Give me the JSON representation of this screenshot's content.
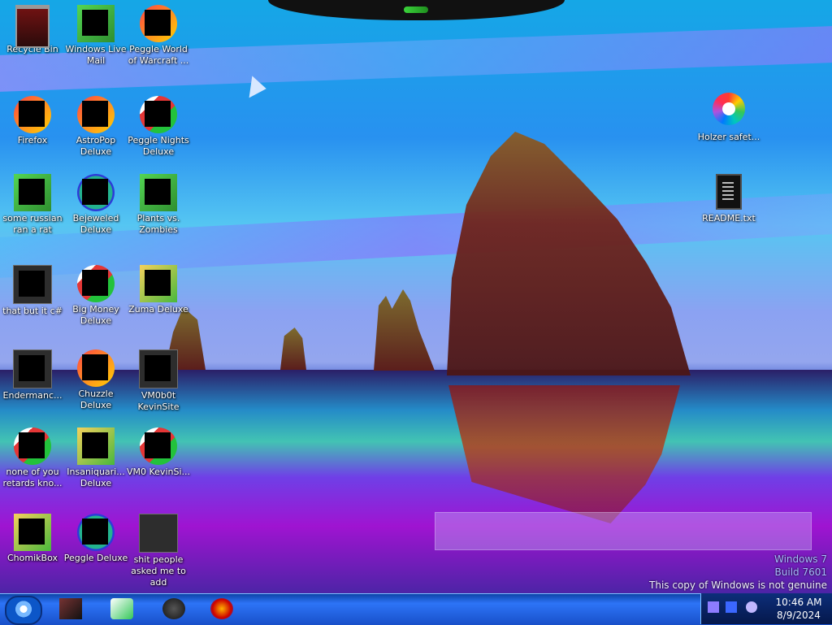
{
  "desktop": {
    "icons": [
      {
        "label": "Recycle Bin",
        "icon": "recycle-bin-icon"
      },
      {
        "label": "Windows Live Mail",
        "icon": "mail-icon"
      },
      {
        "label": "Peggle World of Warcraft ...",
        "icon": "game-icon"
      },
      {
        "label": "Firefox",
        "icon": "firefox-icon"
      },
      {
        "label": "AstroPop Deluxe",
        "icon": "game-icon"
      },
      {
        "label": "Peggle Nights Deluxe",
        "icon": "game-icon"
      },
      {
        "label": "Holzer safet...",
        "icon": "color-wheel-icon"
      },
      {
        "label": "README.txt",
        "icon": "text-file-icon"
      },
      {
        "label": "some russian ran a rat",
        "icon": "game-icon"
      },
      {
        "label": "Bejeweled Deluxe",
        "icon": "game-icon"
      },
      {
        "label": "Plants vs. Zombies",
        "icon": "game-icon"
      },
      {
        "label": "that but it c#",
        "icon": "app-icon"
      },
      {
        "label": "Big Money Deluxe",
        "icon": "game-icon"
      },
      {
        "label": "Zuma Deluxe",
        "icon": "game-icon"
      },
      {
        "label": "Endermanc...",
        "icon": "app-icon"
      },
      {
        "label": "Chuzzle Deluxe",
        "icon": "game-icon"
      },
      {
        "label": "VM0b0t KevinSite",
        "icon": "app-icon"
      },
      {
        "label": "none of you retards kno...",
        "icon": "app-icon"
      },
      {
        "label": "Insaniquari... Deluxe",
        "icon": "game-icon"
      },
      {
        "label": "VM0 KevinSi...",
        "icon": "app-icon"
      },
      {
        "label": "ChomikBox",
        "icon": "app-icon"
      },
      {
        "label": "Peggle Deluxe",
        "icon": "game-icon"
      },
      {
        "label": "shit people asked me to add",
        "icon": "folder-icon"
      }
    ]
  },
  "watermark": {
    "line1": "Windows 7",
    "line2": "Build 7601",
    "line3": "This copy of Windows is not genuine"
  },
  "taskbar": {
    "time": "10:46 AM",
    "date": "8/9/2024"
  },
  "colors": {
    "taskbar": "#1f5ed9",
    "tray": "#0a1d57",
    "accent_green": "#2fc52f"
  }
}
